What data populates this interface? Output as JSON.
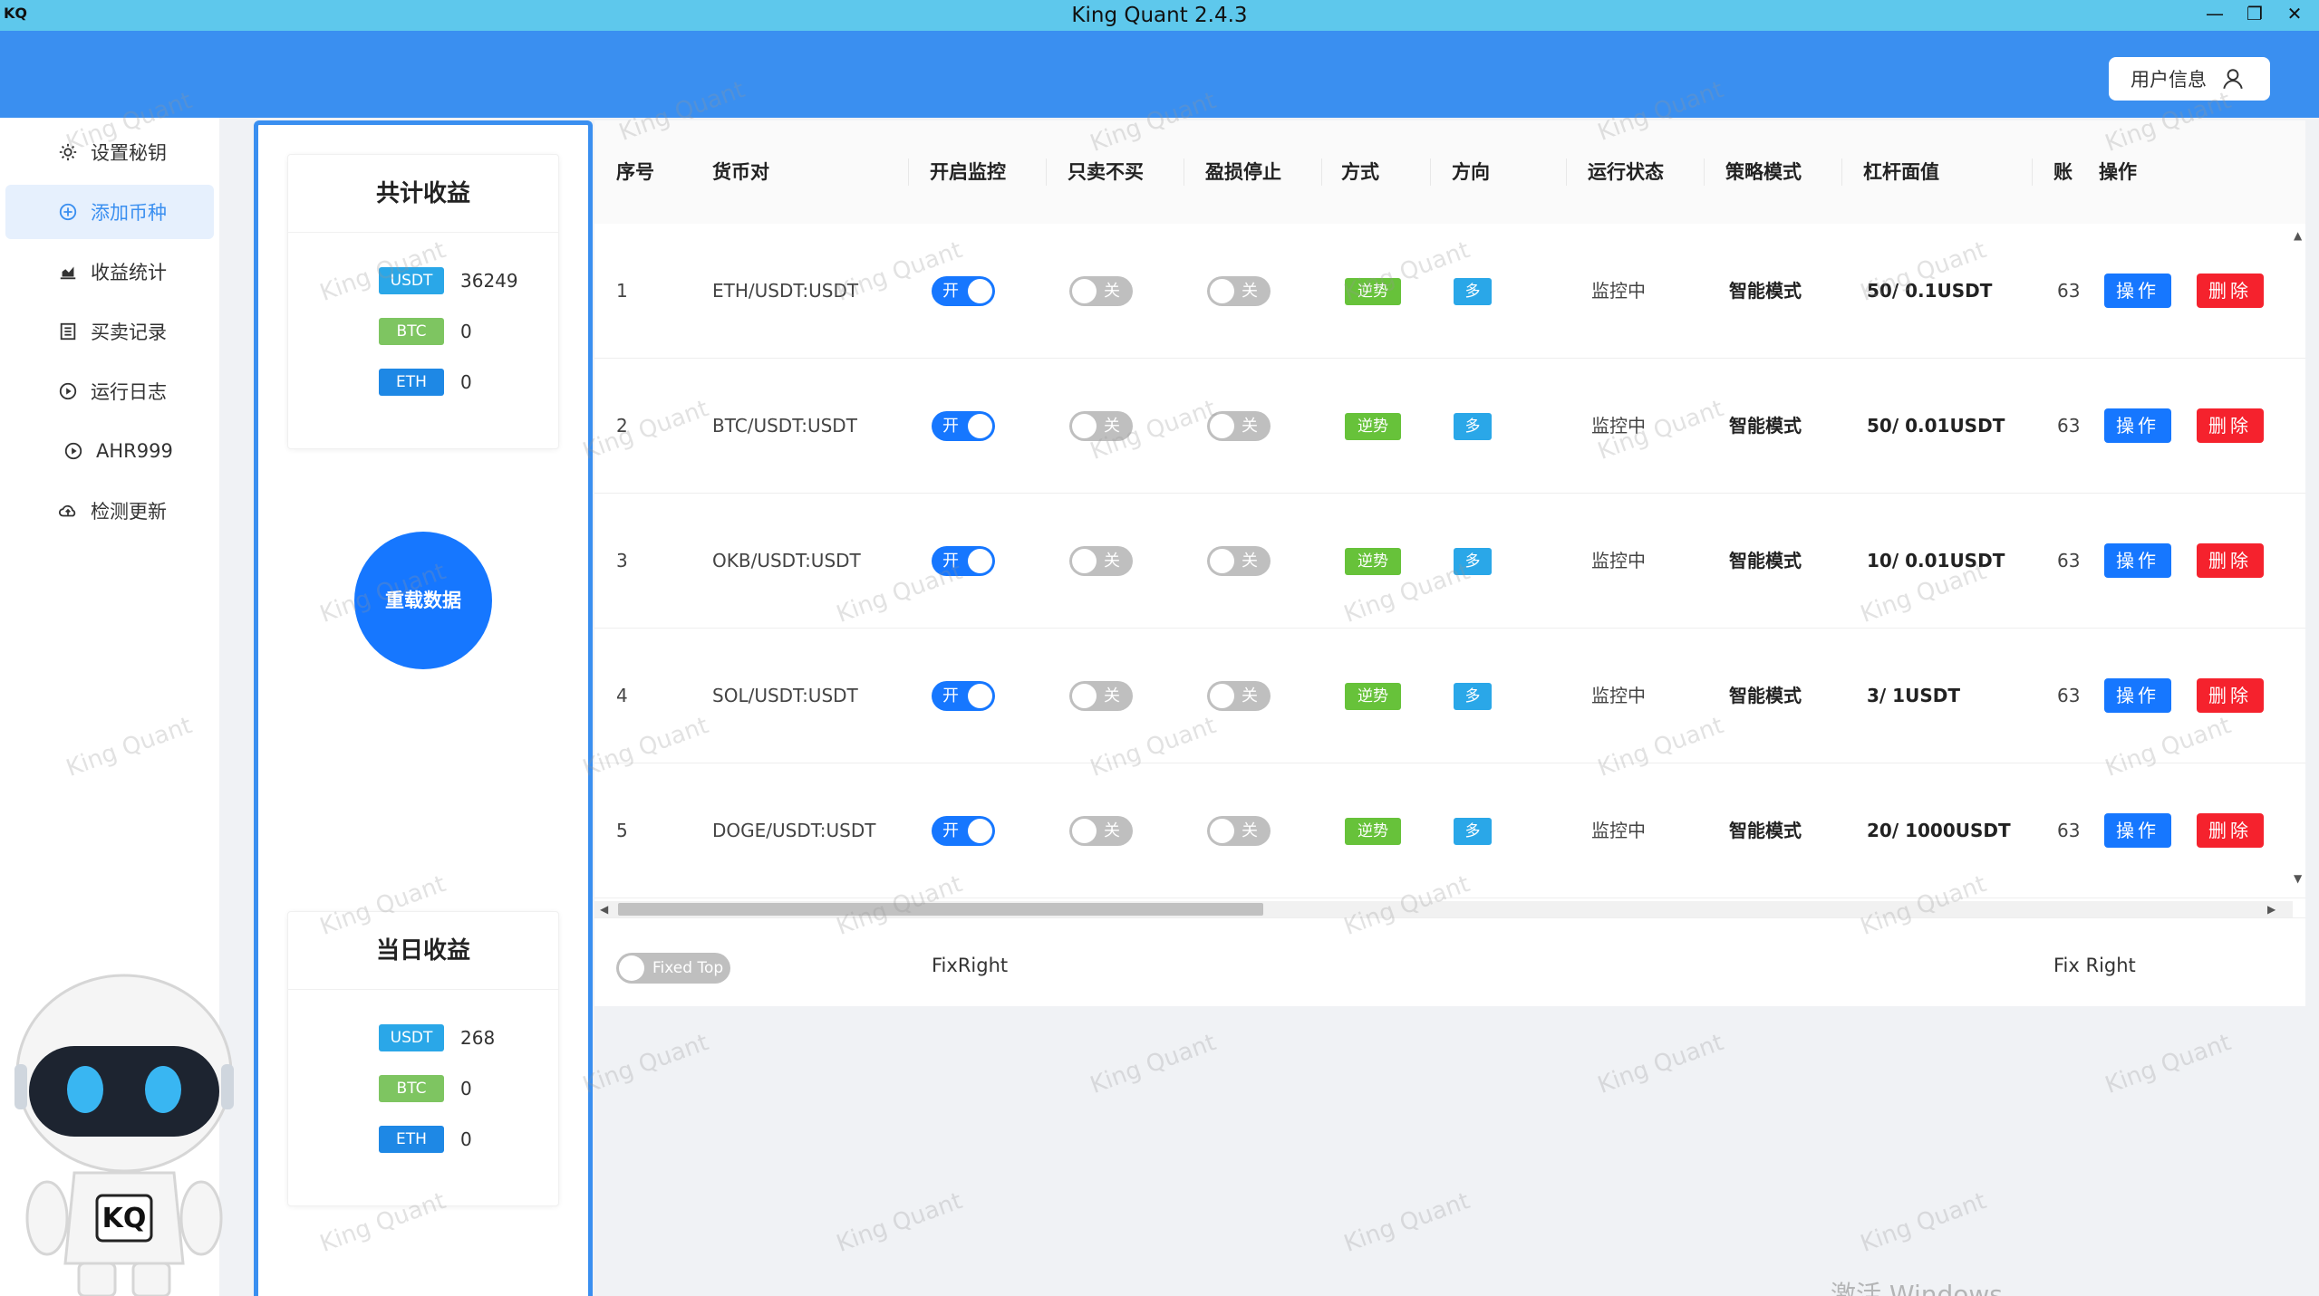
{
  "window": {
    "title": "King Quant 2.4.3",
    "logo": "KQ",
    "minimize_icon": "minimize-icon",
    "restore_icon": "restore-icon",
    "close_icon": "close-icon"
  },
  "header": {
    "user_button_label": "用户信息",
    "user_icon": "user-icon"
  },
  "sidebar": {
    "items": [
      {
        "label": "设置秘钥",
        "icon": "gear-icon",
        "active": false
      },
      {
        "label": "添加币种",
        "icon": "plus-circle-icon",
        "active": true
      },
      {
        "label": "收益统计",
        "icon": "chart-icon",
        "active": false
      },
      {
        "label": "买卖记录",
        "icon": "list-icon",
        "active": false
      },
      {
        "label": "运行日志",
        "icon": "play-circle-icon",
        "active": false
      },
      {
        "label": "AHR999",
        "icon": "play-circle-icon",
        "active": false
      },
      {
        "label": "检测更新",
        "icon": "cloud-icon",
        "active": false
      }
    ]
  },
  "summary": {
    "total_title": "共计收益",
    "total": [
      {
        "coin": "USDT",
        "value": "36249"
      },
      {
        "coin": "BTC",
        "value": "0"
      },
      {
        "coin": "ETH",
        "value": "0"
      }
    ],
    "reload_label": "重载数据",
    "daily_title": "当日收益",
    "daily": [
      {
        "coin": "USDT",
        "value": "268"
      },
      {
        "coin": "BTC",
        "value": "0"
      },
      {
        "coin": "ETH",
        "value": "0"
      }
    ]
  },
  "table": {
    "columns": [
      "序号",
      "货币对",
      "开启监控",
      "只卖不买",
      "盈损停止",
      "方式",
      "方向",
      "运行状态",
      "策略模式",
      "杠杆面值",
      "账",
      "操作"
    ],
    "rows": [
      {
        "index": "1",
        "pair": "ETH/USDT:USDT",
        "monitor": "开",
        "sell_only": "关",
        "stop": "关",
        "mode": "逆势",
        "direction": "多",
        "status": "监控中",
        "strategy": "智能模式",
        "leverage": "50/ 0.1USDT",
        "account": "63",
        "op": "操作",
        "del": "删除"
      },
      {
        "index": "2",
        "pair": "BTC/USDT:USDT",
        "monitor": "开",
        "sell_only": "关",
        "stop": "关",
        "mode": "逆势",
        "direction": "多",
        "status": "监控中",
        "strategy": "智能模式",
        "leverage": "50/ 0.01USDT",
        "account": "63",
        "op": "操作",
        "del": "删除"
      },
      {
        "index": "3",
        "pair": "OKB/USDT:USDT",
        "monitor": "开",
        "sell_only": "关",
        "stop": "关",
        "mode": "逆势",
        "direction": "多",
        "status": "监控中",
        "strategy": "智能模式",
        "leverage": "10/ 0.01USDT",
        "account": "63",
        "op": "操作",
        "del": "删除"
      },
      {
        "index": "4",
        "pair": "SOL/USDT:USDT",
        "monitor": "开",
        "sell_only": "关",
        "stop": "关",
        "mode": "逆势",
        "direction": "多",
        "status": "监控中",
        "strategy": "智能模式",
        "leverage": "3/ 1USDT",
        "account": "63",
        "op": "操作",
        "del": "删除"
      },
      {
        "index": "5",
        "pair": "DOGE/USDT:USDT",
        "monitor": "开",
        "sell_only": "关",
        "stop": "关",
        "mode": "逆势",
        "direction": "多",
        "status": "监控中",
        "strategy": "智能模式",
        "leverage": "20/ 1000USDT",
        "account": "63",
        "op": "操作",
        "del": "删除"
      }
    ]
  },
  "footer": {
    "fixed_top_label": "Fixed Top",
    "fix_right_left": "FixRight",
    "fix_right_right": "Fix Right"
  },
  "watermark_text": "King Quant",
  "windows_activation": "激活 Windows",
  "colors": {
    "titlebar": "#5ec8ec",
    "header": "#3a8ff0",
    "primary": "#1677ff",
    "danger": "#f5222d",
    "green": "#67c23a"
  }
}
